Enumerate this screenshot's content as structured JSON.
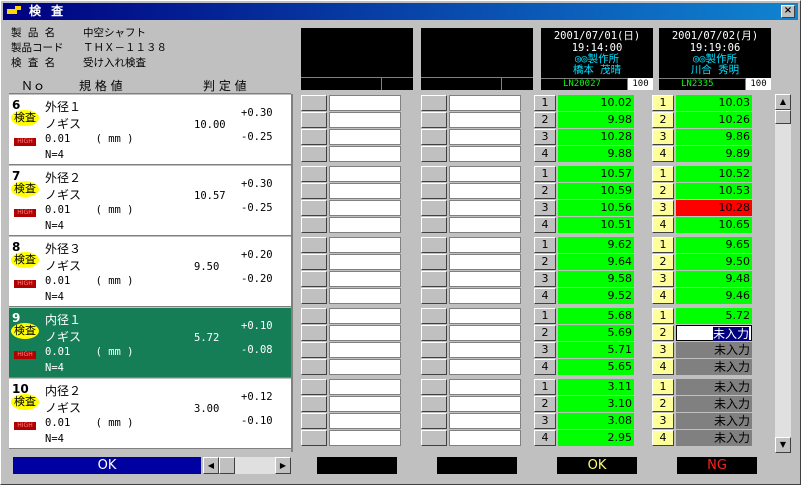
{
  "window": {
    "title": "検 査",
    "close": "×"
  },
  "info": [
    {
      "label": "製 品 名",
      "value": "中空シャフト"
    },
    {
      "label": "製品コード",
      "value": "ＴＨＸ－１１３８"
    },
    {
      "label": "検 査 名",
      "value": "受け入れ検査"
    }
  ],
  "headers": {
    "no": "Ｎｏ",
    "spec": "規 格 値",
    "judge": "判 定 値"
  },
  "meters": [
    {
      "date": "2001/07/01(日)",
      "time": "19:14:00",
      "company": "◎◎製作所",
      "person": "橋本 茂晴",
      "ln": "LN20027",
      "count": "100"
    },
    {
      "date": "2001/07/02(月)",
      "time": "19:19:06",
      "company": "◎◎製作所",
      "person": "川合 秀明",
      "ln": "LN2335",
      "count": "100"
    }
  ],
  "items": [
    {
      "no": "6",
      "badge": "検査",
      "tag": "HIGH",
      "name": "外径１",
      "tool": "ノギス",
      "precision": "0.01    ( mm )",
      "n": "N=4",
      "standard": "10.00",
      "upper": "+0.30",
      "lower": "-0.25",
      "m1": [
        "10.02",
        "9.98",
        "10.28",
        "9.88"
      ],
      "m2": [
        "10.03",
        "10.26",
        "9.86",
        "9.89"
      ]
    },
    {
      "no": "7",
      "badge": "検査",
      "tag": "HIGH",
      "name": "外径２",
      "tool": "ノギス",
      "precision": "0.01    ( mm )",
      "n": "N=4",
      "standard": "10.57",
      "upper": "+0.30",
      "lower": "-0.25",
      "m1": [
        "10.57",
        "10.59",
        "10.56",
        "10.51"
      ],
      "m2": [
        "10.52",
        "10.53",
        "10.28",
        "10.65"
      ]
    },
    {
      "no": "8",
      "badge": "検査",
      "tag": "HIGH",
      "name": "外径３",
      "tool": "ノギス",
      "precision": "0.01    ( mm )",
      "n": "N=4",
      "standard": "9.50",
      "upper": "+0.20",
      "lower": "-0.20",
      "m1": [
        "9.62",
        "9.64",
        "9.58",
        "9.52"
      ],
      "m2": [
        "9.65",
        "9.50",
        "9.48",
        "9.46"
      ]
    },
    {
      "no": "9",
      "badge": "検査",
      "tag": "HIGH",
      "name": "内径１",
      "tool": "ノギス",
      "precision": "0.01    ( mm )",
      "n": "N=4",
      "standard": "5.72",
      "upper": "+0.10",
      "lower": "-0.08",
      "m1": [
        "5.68",
        "5.69",
        "5.71",
        "5.65"
      ],
      "m2": [
        "5.72",
        "未入力",
        "未入力",
        "未入力"
      ]
    },
    {
      "no": "10",
      "badge": "検査",
      "tag": "HIGH",
      "name": "内径２",
      "tool": "ノギス",
      "precision": "0.01    ( mm )",
      "n": "N=4",
      "standard": "3.00",
      "upper": "+0.12",
      "lower": "-0.10",
      "m1": [
        "3.11",
        "3.10",
        "3.08",
        "2.95"
      ],
      "m2": [
        "未入力",
        "未入力",
        "未入力",
        "未入力"
      ]
    }
  ],
  "indices": [
    "1",
    "2",
    "3",
    "4"
  ],
  "status": {
    "left": "OK",
    "m1": "OK",
    "m2": "NG"
  },
  "colors": {
    "ok_bg": "#00ff00",
    "ng_bg": "#ff0000",
    "selected_row": "#157e57",
    "title_bar": "#000080"
  }
}
